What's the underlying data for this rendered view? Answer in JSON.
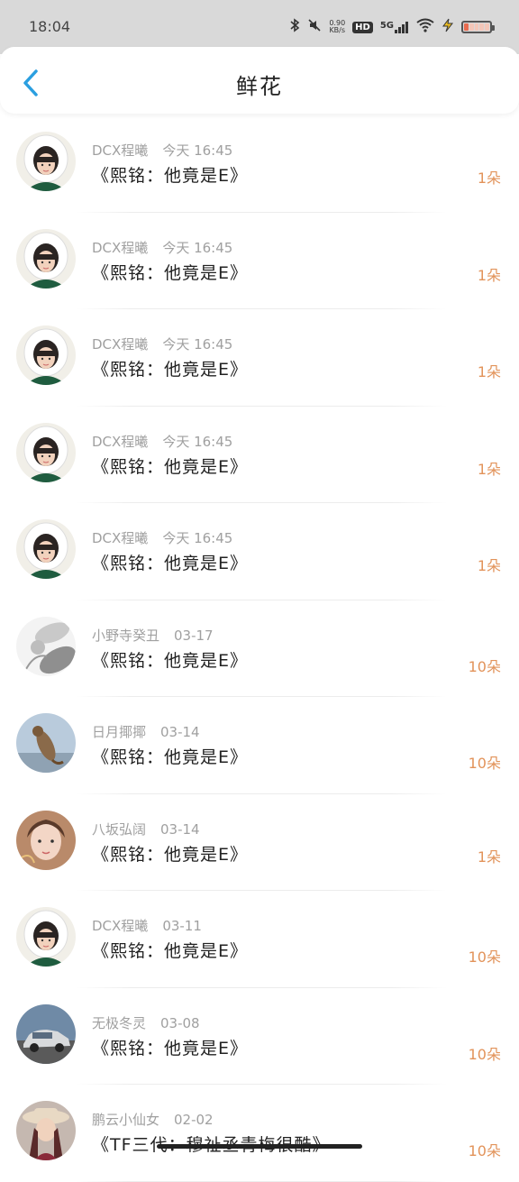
{
  "status_bar": {
    "time": "18:04",
    "net_speed_value": "0.90",
    "net_speed_unit": "KB/s",
    "hd": "HD",
    "network": "5G"
  },
  "header": {
    "title": "鲜花",
    "accent_color": "#2b9fe0"
  },
  "rows": [
    {
      "user": "DCX程曦",
      "date": "今天 16:45",
      "title": "《熙铭：他竟是E》",
      "count": "1朵",
      "avatar": "girl-white-hood"
    },
    {
      "user": "DCX程曦",
      "date": "今天 16:45",
      "title": "《熙铭：他竟是E》",
      "count": "1朵",
      "avatar": "girl-white-hood"
    },
    {
      "user": "DCX程曦",
      "date": "今天 16:45",
      "title": "《熙铭：他竟是E》",
      "count": "1朵",
      "avatar": "girl-white-hood"
    },
    {
      "user": "DCX程曦",
      "date": "今天 16:45",
      "title": "《熙铭：他竟是E》",
      "count": "1朵",
      "avatar": "girl-white-hood"
    },
    {
      "user": "DCX程曦",
      "date": "今天 16:45",
      "title": "《熙铭：他竟是E》",
      "count": "1朵",
      "avatar": "girl-white-hood"
    },
    {
      "user": "小野寺癸丑",
      "date": "03-17",
      "title": "《熙铭：他竟是E》",
      "count": "10朵",
      "avatar": "grey-sketch"
    },
    {
      "user": "日月揶揶",
      "date": "03-14",
      "title": "《熙铭：他竟是E》",
      "count": "10朵",
      "avatar": "cat-sky"
    },
    {
      "user": "八坂弘阔",
      "date": "03-14",
      "title": "《熙铭：他竟是E》",
      "count": "1朵",
      "avatar": "girl-face"
    },
    {
      "user": "DCX程曦",
      "date": "03-11",
      "title": "《熙铭：他竟是E》",
      "count": "10朵",
      "avatar": "girl-white-hood"
    },
    {
      "user": "无极冬灵",
      "date": "03-08",
      "title": "《熙铭：他竟是E》",
      "count": "10朵",
      "avatar": "car"
    },
    {
      "user": "鹏云小仙女",
      "date": "02-02",
      "title": "《TF三代：穆祉丞青梅很酷》",
      "count": "10朵",
      "avatar": "girl-hat"
    }
  ],
  "colors": {
    "count": "#e2935a",
    "meta": "#a0a0a0"
  }
}
